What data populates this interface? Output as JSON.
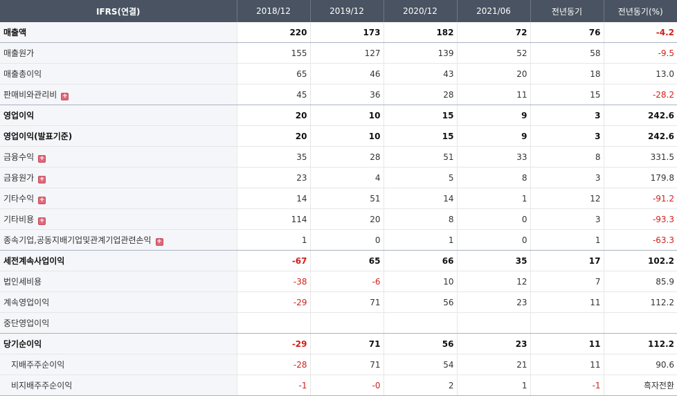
{
  "header": [
    "IFRS(연결)",
    "2018/12",
    "2019/12",
    "2020/12",
    "2021/06",
    "전년동기",
    "전년동기(%)"
  ],
  "rows": [
    {
      "label": "매출액",
      "bold": true,
      "expand": false,
      "sub": false,
      "sep": true,
      "values": [
        "220",
        "173",
        "182",
        "72",
        "76",
        "-4.2"
      ]
    },
    {
      "label": "매출원가",
      "bold": false,
      "expand": false,
      "sub": false,
      "sep": false,
      "values": [
        "155",
        "127",
        "139",
        "52",
        "58",
        "-9.5"
      ]
    },
    {
      "label": "매출총이익",
      "bold": false,
      "expand": false,
      "sub": false,
      "sep": false,
      "values": [
        "65",
        "46",
        "43",
        "20",
        "18",
        "13.0"
      ]
    },
    {
      "label": "판매비와관리비",
      "bold": false,
      "expand": true,
      "sub": false,
      "sep": true,
      "values": [
        "45",
        "36",
        "28",
        "11",
        "15",
        "-28.2"
      ]
    },
    {
      "label": "영업이익",
      "bold": true,
      "expand": false,
      "sub": false,
      "sep": false,
      "values": [
        "20",
        "10",
        "15",
        "9",
        "3",
        "242.6"
      ]
    },
    {
      "label": "영업이익(발표기준)",
      "bold": true,
      "expand": false,
      "sub": false,
      "sep": false,
      "values": [
        "20",
        "10",
        "15",
        "9",
        "3",
        "242.6"
      ]
    },
    {
      "label": "금융수익",
      "bold": false,
      "expand": true,
      "sub": false,
      "sep": false,
      "values": [
        "35",
        "28",
        "51",
        "33",
        "8",
        "331.5"
      ]
    },
    {
      "label": "금융원가",
      "bold": false,
      "expand": true,
      "sub": false,
      "sep": false,
      "values": [
        "23",
        "4",
        "5",
        "8",
        "3",
        "179.8"
      ]
    },
    {
      "label": "기타수익",
      "bold": false,
      "expand": true,
      "sub": false,
      "sep": false,
      "values": [
        "14",
        "51",
        "14",
        "1",
        "12",
        "-91.2"
      ]
    },
    {
      "label": "기타비용",
      "bold": false,
      "expand": true,
      "sub": false,
      "sep": false,
      "values": [
        "114",
        "20",
        "8",
        "0",
        "3",
        "-93.3"
      ]
    },
    {
      "label": "종속기업,공동지배기업및관계기업관련손익",
      "bold": false,
      "expand": true,
      "sub": false,
      "sep": true,
      "values": [
        "1",
        "0",
        "1",
        "0",
        "1",
        "-63.3"
      ]
    },
    {
      "label": "세전계속사업이익",
      "bold": true,
      "expand": false,
      "sub": false,
      "sep": false,
      "values": [
        "-67",
        "65",
        "66",
        "35",
        "17",
        "102.2"
      ]
    },
    {
      "label": "법인세비용",
      "bold": false,
      "expand": false,
      "sub": false,
      "sep": false,
      "values": [
        "-38",
        "-6",
        "10",
        "12",
        "7",
        "85.9"
      ]
    },
    {
      "label": "계속영업이익",
      "bold": false,
      "expand": false,
      "sub": false,
      "sep": false,
      "values": [
        "-29",
        "71",
        "56",
        "23",
        "11",
        "112.2"
      ]
    },
    {
      "label": "중단영업이익",
      "bold": false,
      "expand": false,
      "sub": false,
      "sep": true,
      "values": [
        "",
        "",
        "",
        "",
        "",
        ""
      ]
    },
    {
      "label": "당기순이익",
      "bold": true,
      "expand": false,
      "sub": false,
      "sep": false,
      "values": [
        "-29",
        "71",
        "56",
        "23",
        "11",
        "112.2"
      ]
    },
    {
      "label": "지배주주순이익",
      "bold": false,
      "expand": false,
      "sub": true,
      "sep": false,
      "values": [
        "-28",
        "71",
        "54",
        "21",
        "11",
        "90.6"
      ]
    },
    {
      "label": "비지배주주순이익",
      "bold": false,
      "expand": false,
      "sub": true,
      "sep": false,
      "values": [
        "-1",
        "-0",
        "2",
        "1",
        "-1",
        "흑자전환"
      ]
    }
  ],
  "icons": {
    "expand": "plus-square-icon",
    "expand_glyph": "+"
  },
  "colors": {
    "header_bg": "#4a5361",
    "negative": "#d0201a",
    "label_bg": "#f5f6f9"
  }
}
